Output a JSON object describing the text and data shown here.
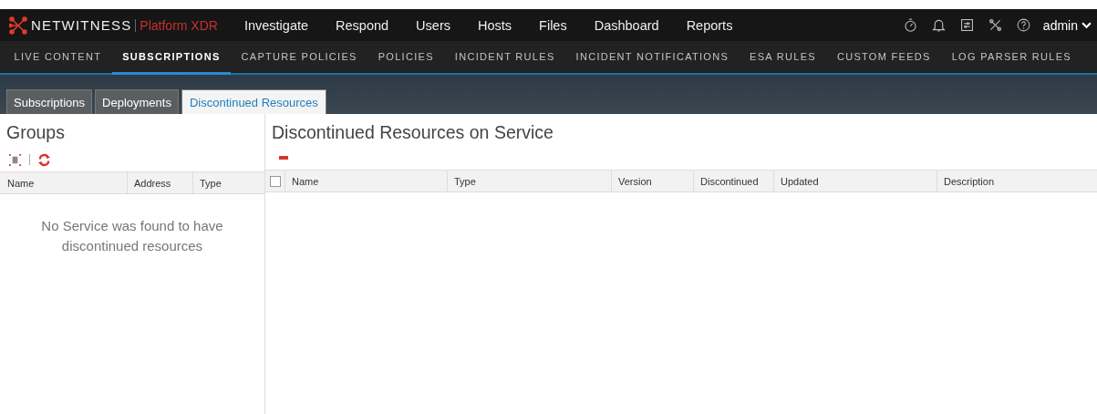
{
  "brand": {
    "name": "NETWITNESS",
    "product": "Platform XDR"
  },
  "nav": [
    "Investigate",
    "Respond",
    "Users",
    "Hosts",
    "Files",
    "Dashboard",
    "Reports"
  ],
  "user": {
    "name": "admin"
  },
  "subnav": [
    {
      "label": "LIVE CONTENT",
      "selected": false
    },
    {
      "label": "SUBSCRIPTIONS",
      "selected": true
    },
    {
      "label": "CAPTURE POLICIES",
      "selected": false
    },
    {
      "label": "POLICIES",
      "selected": false
    },
    {
      "label": "INCIDENT RULES",
      "selected": false
    },
    {
      "label": "INCIDENT NOTIFICATIONS",
      "selected": false
    },
    {
      "label": "ESA RULES",
      "selected": false
    },
    {
      "label": "CUSTOM FEEDS",
      "selected": false
    },
    {
      "label": "LOG PARSER RULES",
      "selected": false
    }
  ],
  "tabs": [
    {
      "label": "Subscriptions",
      "selected": false
    },
    {
      "label": "Deployments",
      "selected": false
    },
    {
      "label": "Discontinued Resources",
      "selected": true
    }
  ],
  "groups": {
    "title": "Groups",
    "columns": [
      "Name",
      "Address",
      "Type"
    ],
    "empty_message": "No Service was found to have discontinued resources"
  },
  "resources": {
    "title": "Discontinued Resources on Service",
    "select_all": {
      "checked": false
    },
    "columns": [
      "Name",
      "Type",
      "Version",
      "Discontinued",
      "Updated",
      "Description"
    ]
  }
}
